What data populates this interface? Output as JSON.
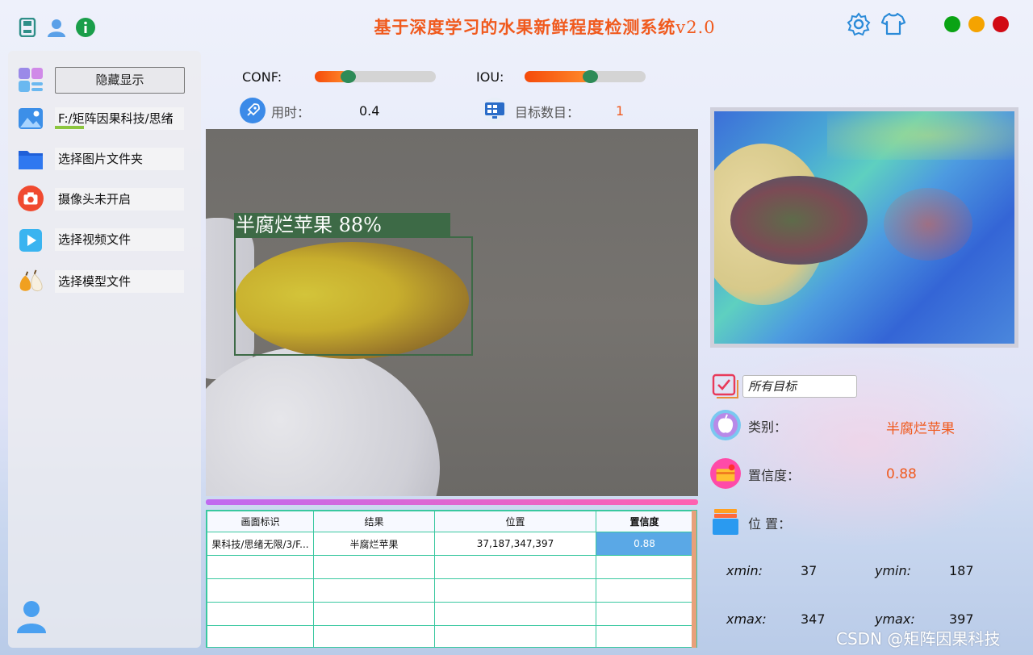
{
  "app": {
    "title": "基于深度学习的水果新鲜程度检测系统",
    "version": "v2.0"
  },
  "titlebar": {
    "left_icons": [
      "save-icon",
      "user-icon",
      "info-icon"
    ],
    "right_icons": [
      "settings-icon",
      "tshirt-icon"
    ],
    "window_controls": [
      {
        "name": "maximize",
        "color": "#0aa314"
      },
      {
        "name": "minimize",
        "color": "#f5a300"
      },
      {
        "name": "close",
        "color": "#d10a14"
      }
    ]
  },
  "sidebar": {
    "toggle_button": "隐藏显示",
    "image_path": "F:/矩阵因果科技/思绪",
    "select_folder": "选择图片文件夹",
    "camera": "摄像头未开启",
    "select_video": "选择视频文件",
    "select_model": "选择模型文件"
  },
  "controls": {
    "conf_label": "CONF:",
    "conf_value": 0.27,
    "iou_label": "IOU:",
    "iou_value": 0.54,
    "time_label": "用时：",
    "time_value": "0.4",
    "count_label": "目标数目：",
    "count_value": "1"
  },
  "detection": {
    "label": "半腐烂苹果  88%"
  },
  "table": {
    "headers": [
      "画面标识",
      "结果",
      "位置",
      "置信度"
    ],
    "rows": [
      [
        "果科技/思绪无限/3/F...",
        "半腐烂苹果",
        "37,187,347,397",
        "0.88"
      ],
      [
        "",
        "",
        "",
        ""
      ],
      [
        "",
        "",
        "",
        ""
      ],
      [
        "",
        "",
        "",
        ""
      ],
      [
        "",
        "",
        "",
        ""
      ]
    ]
  },
  "result_panel": {
    "target_select": "所有目标",
    "class_label": "类别：",
    "class_value": "半腐烂苹果",
    "conf_label": "置信度：",
    "conf_value": "0.88",
    "pos_label": "位 置：",
    "xmin_label": "xmin:",
    "xmin": "37",
    "ymin_label": "ymin:",
    "ymin": "187",
    "xmax_label": "xmax:",
    "xmax": "347",
    "ymax_label": "ymax:",
    "ymax": "397"
  },
  "watermark": "CSDN @矩阵因果科技",
  "colors": {
    "accent_orange": "#f05a1e",
    "slider_thumb": "#2e8b57",
    "table_border": "#3ac8a0",
    "selected_cell": "#5aa8e6"
  }
}
